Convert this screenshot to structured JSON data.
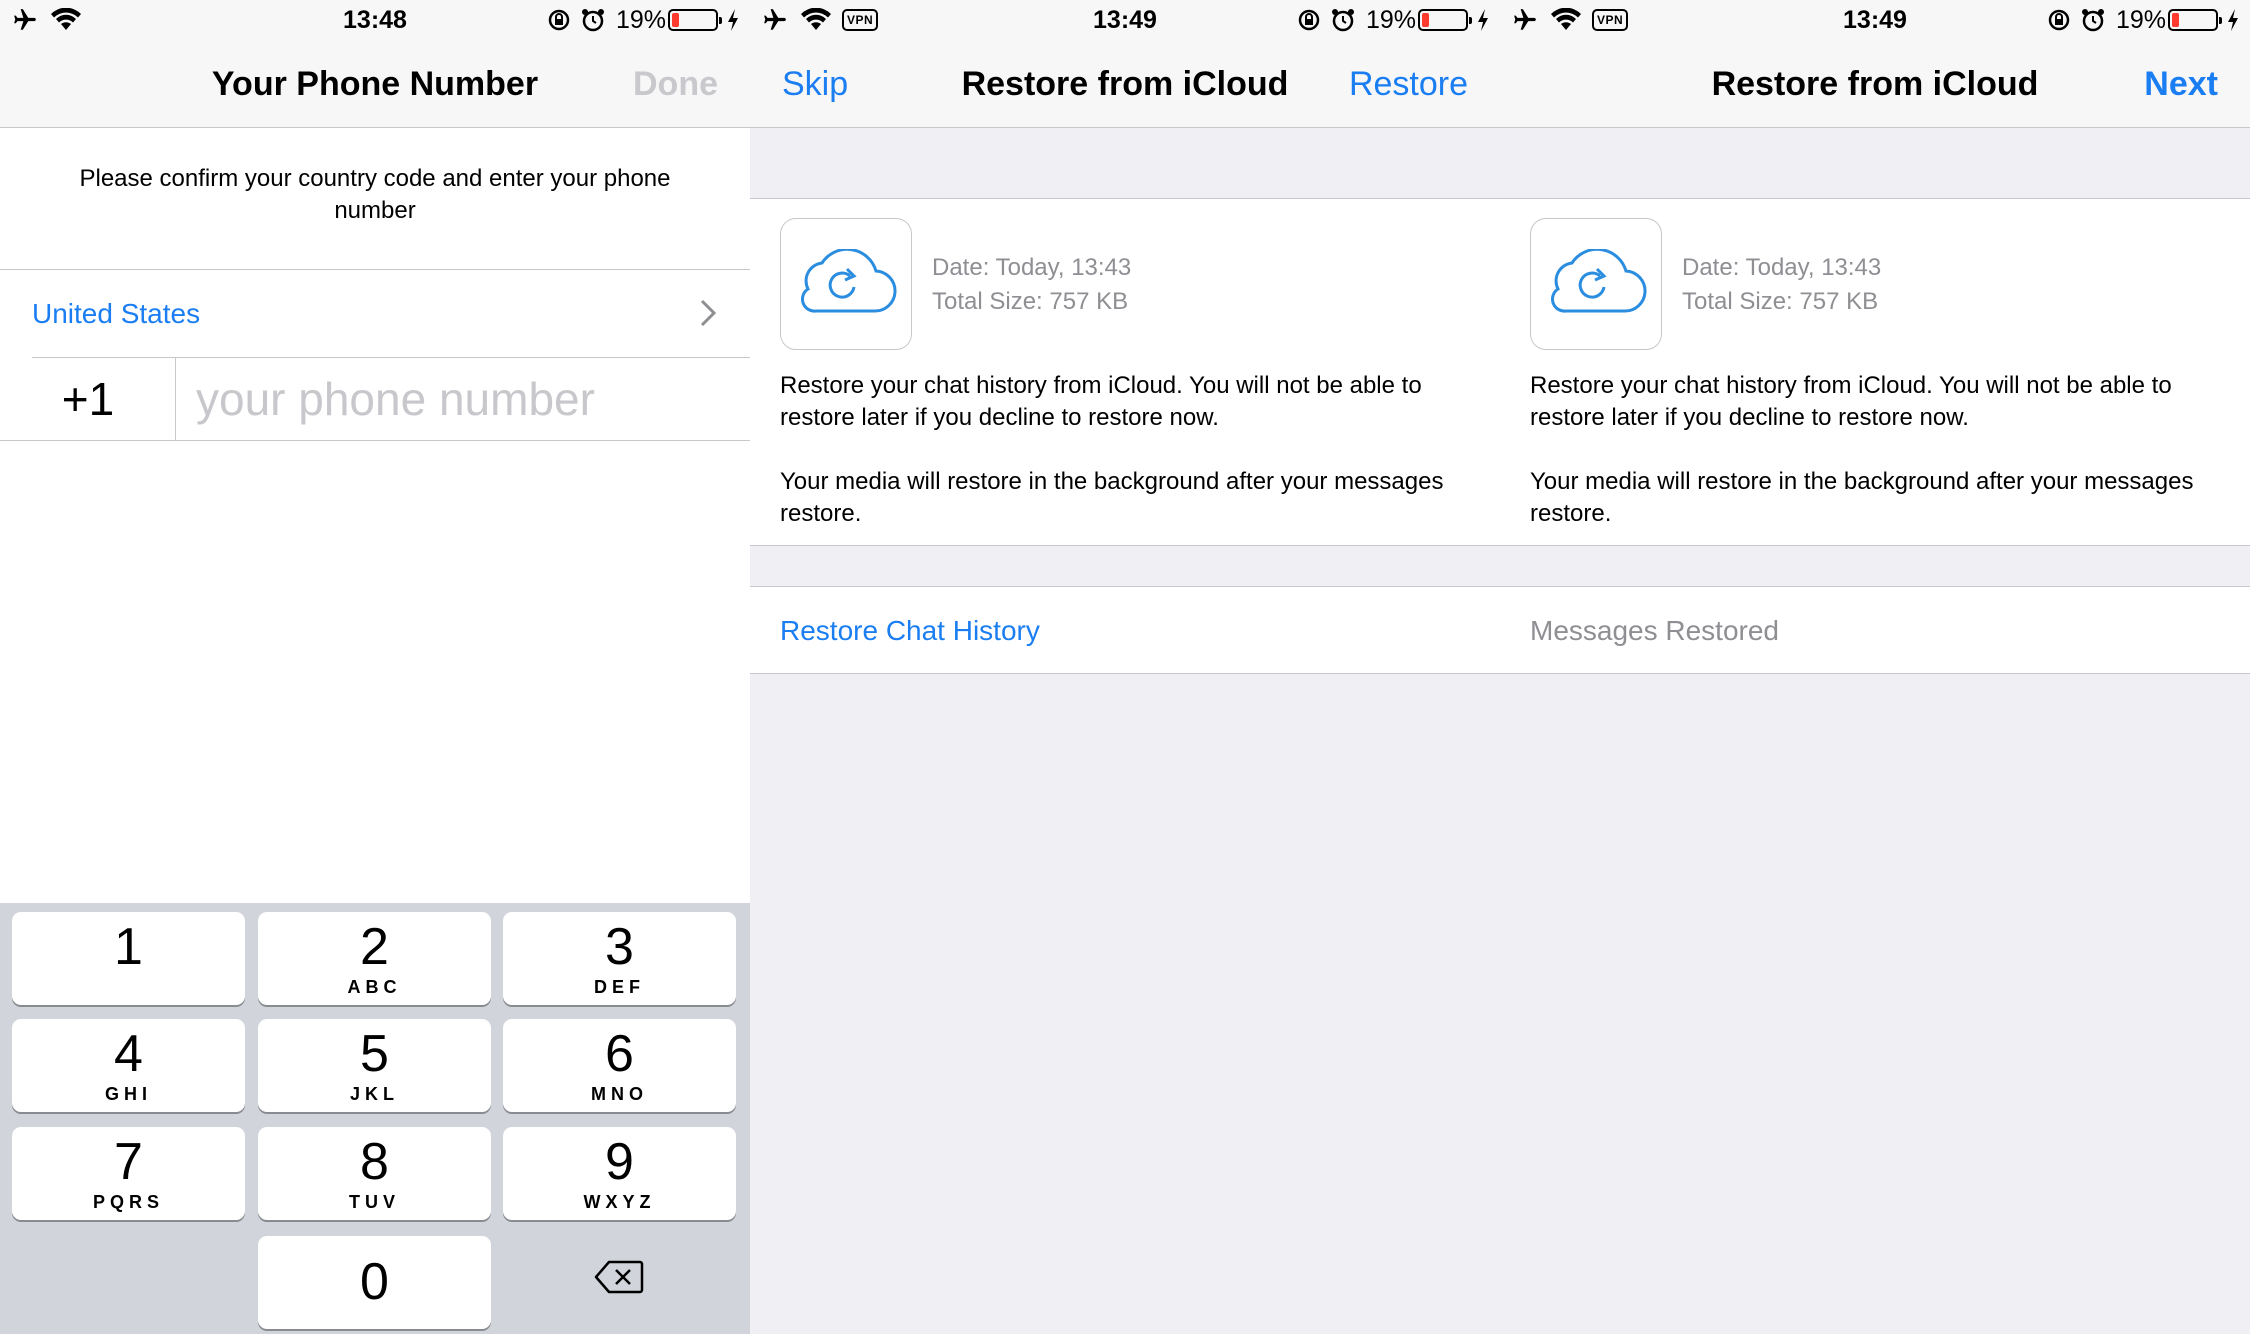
{
  "screens": {
    "phone": {
      "status": {
        "time": "13:48",
        "battery_pct": "19%"
      },
      "nav": {
        "title": "Your Phone Number",
        "done_label": "Done"
      },
      "instruction": "Please confirm your country code and enter your phone number",
      "country": "United States",
      "country_code": "+1",
      "phone_placeholder": "your phone number",
      "keypad": [
        {
          "num": "1",
          "letters": ""
        },
        {
          "num": "2",
          "letters": "ABC"
        },
        {
          "num": "3",
          "letters": "DEF"
        },
        {
          "num": "4",
          "letters": "GHI"
        },
        {
          "num": "5",
          "letters": "JKL"
        },
        {
          "num": "6",
          "letters": "MNO"
        },
        {
          "num": "7",
          "letters": "PQRS"
        },
        {
          "num": "8",
          "letters": "TUV"
        },
        {
          "num": "9",
          "letters": "WXYZ"
        },
        {
          "num": "0",
          "letters": ""
        }
      ]
    },
    "restore": {
      "status": {
        "time": "13:49",
        "battery_pct": "19%",
        "vpn": "VPN"
      },
      "nav": {
        "left_label": "Skip",
        "title": "Restore from iCloud",
        "right_label": "Restore"
      },
      "date": "Date: Today, 13:43",
      "size": "Total Size: 757 KB",
      "para1": "Restore your chat history from iCloud. You will not be able to restore later if you decline to restore now.",
      "para2": "Your media will restore in the background after your messages restore.",
      "action_label": "Restore Chat History"
    },
    "restored": {
      "status": {
        "time": "13:49",
        "battery_pct": "19%",
        "vpn": "VPN"
      },
      "nav": {
        "title": "Restore from iCloud",
        "right_label": "Next"
      },
      "date": "Date: Today, 13:43",
      "size": "Total Size: 757 KB",
      "para1": "Restore your chat history from iCloud. You will not be able to restore later if you decline to restore now.",
      "para2": "Your media will restore in the background after your messages restore.",
      "action_label": "Messages Restored"
    }
  },
  "colors": {
    "accent": "#1a7ef2",
    "battery_low": "#ff3b30",
    "disabled": "#c8c8cd",
    "secondary_text": "#8e8e93"
  },
  "icons": [
    "airplane-icon",
    "wifi-icon",
    "vpn-badge",
    "rotation-lock-icon",
    "alarm-icon",
    "battery-icon",
    "charging-bolt-icon",
    "chevron-right-icon",
    "cloud-restore-icon",
    "backspace-icon"
  ]
}
